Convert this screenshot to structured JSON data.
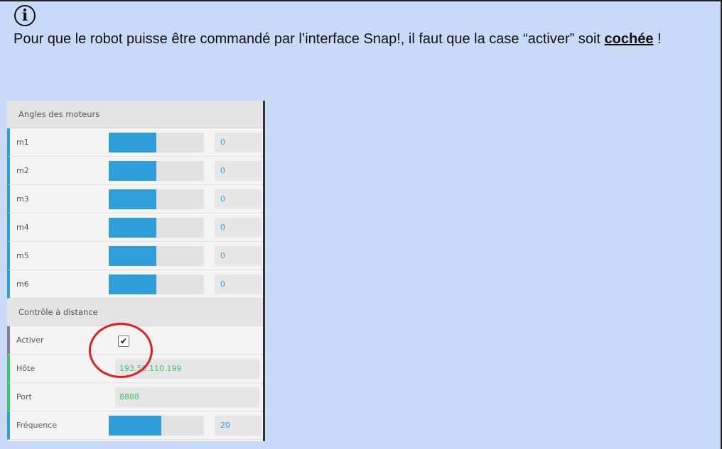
{
  "note": {
    "icon": "info-icon",
    "text_before": "Pour que le robot puisse être commandé par l’interface Snap!, il faut que la case “activer” soit ",
    "emphasis": "cochée",
    "text_after": " !"
  },
  "panel": {
    "motors_header": "Angles des moteurs",
    "motors": [
      {
        "label": "m1",
        "value": "0",
        "fill": 0.5
      },
      {
        "label": "m2",
        "value": "0",
        "fill": 0.5
      },
      {
        "label": "m3",
        "value": "0",
        "fill": 0.5
      },
      {
        "label": "m4",
        "value": "0",
        "fill": 0.5
      },
      {
        "label": "m5",
        "value": "0",
        "fill": 0.5
      },
      {
        "label": "m6",
        "value": "0",
        "fill": 0.5
      }
    ],
    "remote_header": "Contrôle à distance",
    "activate_label": "Activer",
    "activate_checked": "✔",
    "host_label": "Hôte",
    "host_value": "193.50.110.199",
    "port_label": "Port",
    "port_value": "8888",
    "freq_label": "Fréquence",
    "freq_value": "20",
    "freq_fill": 0.55
  },
  "colors": {
    "background": "#c9daf8",
    "accent_blue": "#2f9dd8",
    "accent_green": "#3ec46d",
    "highlight_red": "#e02020"
  }
}
